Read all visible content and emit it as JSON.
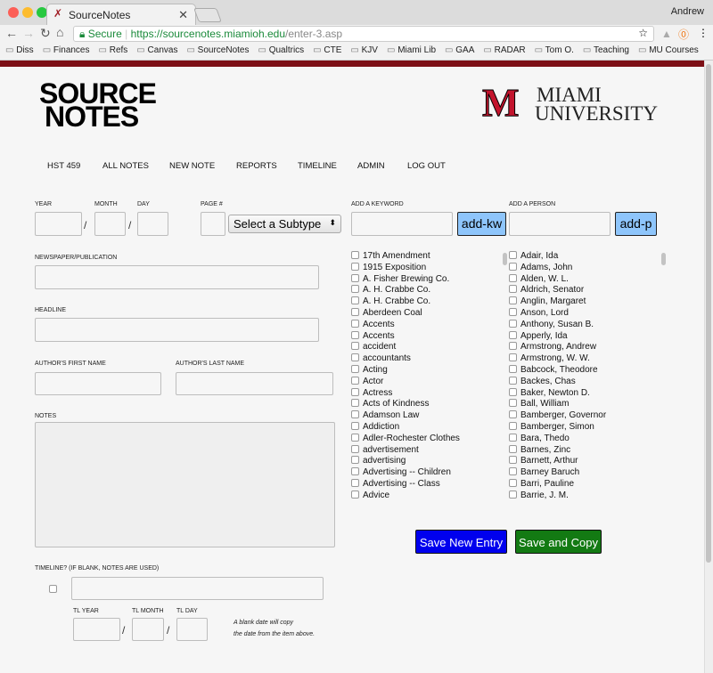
{
  "browser": {
    "tab_title": "SourceNotes",
    "user": "Andrew",
    "secure": "Secure",
    "url_host": "https://sourcenotes.miamioh.edu",
    "url_path": "/enter-3.asp",
    "bookmarks": [
      "Diss",
      "Finances",
      "Refs",
      "Canvas",
      "SourceNotes",
      "Qualtrics",
      "CTE",
      "KJV",
      "Miami Lib",
      "GAA",
      "RADAR",
      "Tom O.",
      "Teaching",
      "MU Courses"
    ]
  },
  "logo": {
    "line1": "SOURCE",
    "line2": "NOTES"
  },
  "university": {
    "mark": "M",
    "line1": "MIAMI",
    "line2": "UNIVERSITY"
  },
  "menu": [
    "HST 459",
    "ALL NOTES",
    "NEW NOTE",
    "REPORTS",
    "TIMELINE",
    "ADMIN",
    "LOG OUT"
  ],
  "form": {
    "year": "YEAR",
    "month": "MONTH",
    "day": "DAY",
    "page": "PAGE #",
    "subtype": "Select a Subtype",
    "add_keyword": "ADD A KEYWORD",
    "add_kw_btn": "add-kw",
    "add_person": "ADD A PERSON",
    "add_p_btn": "add-p",
    "publication": "NEWSPAPER/PUBLICATION",
    "headline": "HEADLINE",
    "author_first": "AUTHOR'S FIRST NAME",
    "author_last": "AUTHOR'S LAST NAME",
    "notes": "NOTES",
    "timeline": "TIMELINE? (IF BLANK, NOTES ARE USED)",
    "tl_year": "TL YEAR",
    "tl_month": "TL MONTH",
    "tl_day": "TL DAY",
    "hint1": "A blank date will copy",
    "hint2": "the date from the item above.",
    "save_new": "Save New Entry",
    "save_copy": "Save and Copy"
  },
  "keywords": [
    "17th Amendment",
    "1915 Exposition",
    "A. Fisher Brewing Co.",
    "A. H. Crabbe Co.",
    "A. H. Crabbe Co.",
    "Aberdeen Coal",
    "Accents",
    "Accents",
    "accident",
    "accountants",
    "Acting",
    "Actor",
    "Actress",
    "Acts of Kindness",
    "Adamson Law",
    "Addiction",
    "Adler-Rochester Clothes",
    "advertisement",
    "advertising",
    "Advertising -- Children",
    "Advertising -- Class",
    "Advice"
  ],
  "people": [
    "Adair, Ida",
    "Adams, John",
    "Alden, W. L.",
    "Aldrich, Senator",
    "Anglin, Margaret",
    "Anson, Lord",
    "Anthony, Susan B.",
    "Apperly, Ida",
    "Armstrong, Andrew",
    "Armstrong, W. W.",
    "Babcock, Theodore",
    "Backes, Chas",
    "Baker, Newton D.",
    "Ball, William",
    "Bamberger, Governor",
    "Bamberger, Simon",
    "Bara, Thedo",
    "Barnes, Zinc",
    "Barnett, Arthur",
    "Barney Baruch",
    "Barri, Pauline",
    "Barrie, J. M."
  ],
  "colors": {
    "maroon": "#7d0f16",
    "miami_red": "#c3142d",
    "add_btn": "#8ec5fb",
    "save_new": "#0000ee",
    "save_copy": "#137a13"
  }
}
